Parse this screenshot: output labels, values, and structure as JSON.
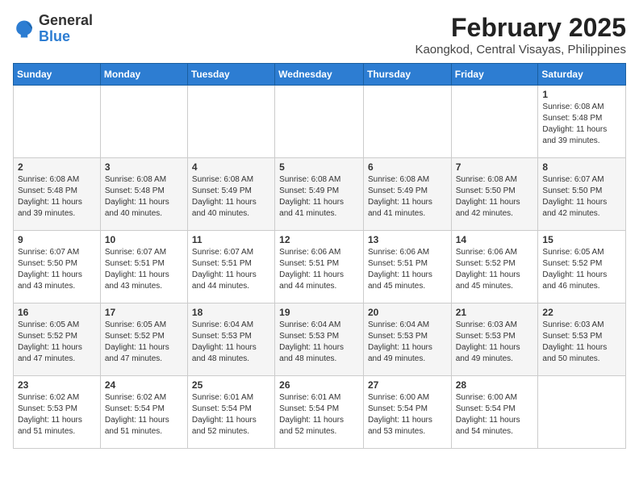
{
  "logo": {
    "general": "General",
    "blue": "Blue"
  },
  "title": "February 2025",
  "subtitle": "Kaongkod, Central Visayas, Philippines",
  "days_of_week": [
    "Sunday",
    "Monday",
    "Tuesday",
    "Wednesday",
    "Thursday",
    "Friday",
    "Saturday"
  ],
  "weeks": [
    [
      {
        "day": "",
        "info": ""
      },
      {
        "day": "",
        "info": ""
      },
      {
        "day": "",
        "info": ""
      },
      {
        "day": "",
        "info": ""
      },
      {
        "day": "",
        "info": ""
      },
      {
        "day": "",
        "info": ""
      },
      {
        "day": "1",
        "info": "Sunrise: 6:08 AM\nSunset: 5:48 PM\nDaylight: 11 hours\nand 39 minutes."
      }
    ],
    [
      {
        "day": "2",
        "info": "Sunrise: 6:08 AM\nSunset: 5:48 PM\nDaylight: 11 hours\nand 39 minutes."
      },
      {
        "day": "3",
        "info": "Sunrise: 6:08 AM\nSunset: 5:48 PM\nDaylight: 11 hours\nand 40 minutes."
      },
      {
        "day": "4",
        "info": "Sunrise: 6:08 AM\nSunset: 5:49 PM\nDaylight: 11 hours\nand 40 minutes."
      },
      {
        "day": "5",
        "info": "Sunrise: 6:08 AM\nSunset: 5:49 PM\nDaylight: 11 hours\nand 41 minutes."
      },
      {
        "day": "6",
        "info": "Sunrise: 6:08 AM\nSunset: 5:49 PM\nDaylight: 11 hours\nand 41 minutes."
      },
      {
        "day": "7",
        "info": "Sunrise: 6:08 AM\nSunset: 5:50 PM\nDaylight: 11 hours\nand 42 minutes."
      },
      {
        "day": "8",
        "info": "Sunrise: 6:07 AM\nSunset: 5:50 PM\nDaylight: 11 hours\nand 42 minutes."
      }
    ],
    [
      {
        "day": "9",
        "info": "Sunrise: 6:07 AM\nSunset: 5:50 PM\nDaylight: 11 hours\nand 43 minutes."
      },
      {
        "day": "10",
        "info": "Sunrise: 6:07 AM\nSunset: 5:51 PM\nDaylight: 11 hours\nand 43 minutes."
      },
      {
        "day": "11",
        "info": "Sunrise: 6:07 AM\nSunset: 5:51 PM\nDaylight: 11 hours\nand 44 minutes."
      },
      {
        "day": "12",
        "info": "Sunrise: 6:06 AM\nSunset: 5:51 PM\nDaylight: 11 hours\nand 44 minutes."
      },
      {
        "day": "13",
        "info": "Sunrise: 6:06 AM\nSunset: 5:51 PM\nDaylight: 11 hours\nand 45 minutes."
      },
      {
        "day": "14",
        "info": "Sunrise: 6:06 AM\nSunset: 5:52 PM\nDaylight: 11 hours\nand 45 minutes."
      },
      {
        "day": "15",
        "info": "Sunrise: 6:05 AM\nSunset: 5:52 PM\nDaylight: 11 hours\nand 46 minutes."
      }
    ],
    [
      {
        "day": "16",
        "info": "Sunrise: 6:05 AM\nSunset: 5:52 PM\nDaylight: 11 hours\nand 47 minutes."
      },
      {
        "day": "17",
        "info": "Sunrise: 6:05 AM\nSunset: 5:52 PM\nDaylight: 11 hours\nand 47 minutes."
      },
      {
        "day": "18",
        "info": "Sunrise: 6:04 AM\nSunset: 5:53 PM\nDaylight: 11 hours\nand 48 minutes."
      },
      {
        "day": "19",
        "info": "Sunrise: 6:04 AM\nSunset: 5:53 PM\nDaylight: 11 hours\nand 48 minutes."
      },
      {
        "day": "20",
        "info": "Sunrise: 6:04 AM\nSunset: 5:53 PM\nDaylight: 11 hours\nand 49 minutes."
      },
      {
        "day": "21",
        "info": "Sunrise: 6:03 AM\nSunset: 5:53 PM\nDaylight: 11 hours\nand 49 minutes."
      },
      {
        "day": "22",
        "info": "Sunrise: 6:03 AM\nSunset: 5:53 PM\nDaylight: 11 hours\nand 50 minutes."
      }
    ],
    [
      {
        "day": "23",
        "info": "Sunrise: 6:02 AM\nSunset: 5:53 PM\nDaylight: 11 hours\nand 51 minutes."
      },
      {
        "day": "24",
        "info": "Sunrise: 6:02 AM\nSunset: 5:54 PM\nDaylight: 11 hours\nand 51 minutes."
      },
      {
        "day": "25",
        "info": "Sunrise: 6:01 AM\nSunset: 5:54 PM\nDaylight: 11 hours\nand 52 minutes."
      },
      {
        "day": "26",
        "info": "Sunrise: 6:01 AM\nSunset: 5:54 PM\nDaylight: 11 hours\nand 52 minutes."
      },
      {
        "day": "27",
        "info": "Sunrise: 6:00 AM\nSunset: 5:54 PM\nDaylight: 11 hours\nand 53 minutes."
      },
      {
        "day": "28",
        "info": "Sunrise: 6:00 AM\nSunset: 5:54 PM\nDaylight: 11 hours\nand 54 minutes."
      },
      {
        "day": "",
        "info": ""
      }
    ]
  ]
}
